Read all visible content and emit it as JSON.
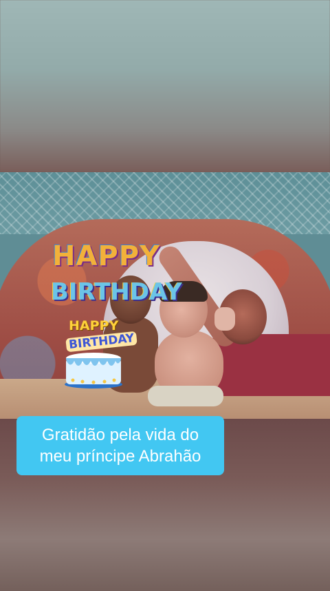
{
  "background": {
    "blur_top_color": "#9fb7b6",
    "blur_bottom_color": "#6c4a4a"
  },
  "stickers": {
    "happy_text": "HAPPY",
    "birthday_text": "BIRTHDAY",
    "cake_happy_text": "HAPPY",
    "cake_birthday_text": "BIRTHDAY"
  },
  "caption": {
    "line1": "Gratidão  pela vida do",
    "line2": "meu príncipe Abrahão",
    "background_color": "#42c7f2",
    "text_color": "#ffffff"
  }
}
